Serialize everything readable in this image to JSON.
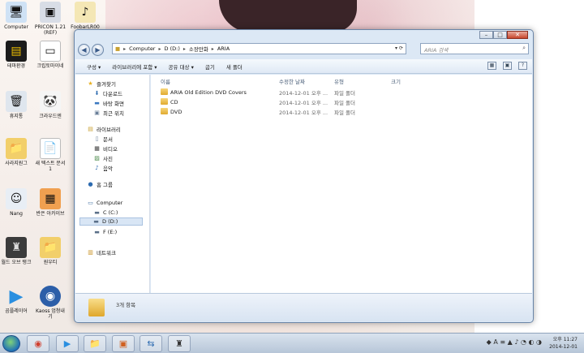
{
  "desktop": {
    "icons": [
      {
        "label": "Computer",
        "glyph": "🖥"
      },
      {
        "label": "PRICON 1.21 (REF)",
        "glyph": "▣"
      },
      {
        "label": "FoobarLR00",
        "glyph": "♪"
      },
      {
        "label": "테마환경",
        "glyph": "▤"
      },
      {
        "label": "크립토마이네",
        "glyph": "▭"
      },
      {
        "label": "휴지통",
        "glyph": "🗑"
      },
      {
        "label": "크라우드엔",
        "glyph": "🐼"
      },
      {
        "label": "사라지원그",
        "glyph": "📁"
      },
      {
        "label": "새 텍스트 문서 1",
        "glyph": "📄"
      },
      {
        "label": "Nang",
        "glyph": "☺"
      },
      {
        "label": "반은 아카이브",
        "glyph": "▦"
      },
      {
        "label": "월드 오브 탱크",
        "glyph": "♜"
      },
      {
        "label": "원우티",
        "glyph": "📁"
      },
      {
        "label": "곰플레이어",
        "glyph": "▶"
      },
      {
        "label": "Kaoss 엄청내기",
        "glyph": "◉"
      }
    ]
  },
  "window": {
    "caption_buttons": {
      "minimize": "–",
      "maximize": "□",
      "close": "✕"
    },
    "nav": {
      "back": "◀",
      "forward": "▶"
    },
    "address": {
      "crumbs": [
        "Computer",
        "D (D:)",
        "소장만화",
        "ARIA"
      ],
      "separator": "▸",
      "controls": "▾  ⟳"
    },
    "search_placeholder": "ARIA 검색",
    "search_icon": "⌕",
    "toolbar": {
      "items": [
        "구성 ▾",
        "라이브러리에 포함 ▾",
        "공유 대상 ▾",
        "굽기",
        "새 폴더"
      ],
      "right_icons": [
        "▦",
        "▣",
        "?"
      ]
    },
    "nav_pane": {
      "favorites": "즐겨찾기",
      "favorites_items": [
        "다운로드",
        "바탕 화면",
        "최근 위치"
      ],
      "libraries": "라이브러리",
      "libraries_items": [
        "문서",
        "비디오",
        "사진",
        "음악"
      ],
      "homegroup": "홈 그룹",
      "computer": "Computer",
      "drives": [
        "C (C:)",
        "D (D:)",
        "F (E:)"
      ],
      "network": "네트워크"
    },
    "columns": [
      "이름",
      "수정한 날짜",
      "유형",
      "크기"
    ],
    "files": [
      {
        "name": "ARIA Old Edition DVD Covers",
        "date": "2014-12-01 오후 ...",
        "type": "파일 폴더",
        "size": ""
      },
      {
        "name": "CD",
        "date": "2014-12-01 오후 ...",
        "type": "파일 폴더",
        "size": ""
      },
      {
        "name": "DVD",
        "date": "2014-12-01 오후 ...",
        "type": "파일 폴더",
        "size": ""
      }
    ],
    "details_count": "3개 항목"
  },
  "taskbar": {
    "apps": [
      "◉",
      "▶",
      "📁",
      "▣",
      "⇆",
      "♜"
    ],
    "tray": "◆ A ≡ ▲ ♪ ◔ ◐ ◑",
    "time": "오후 11:27",
    "date": "2014-12-01"
  }
}
